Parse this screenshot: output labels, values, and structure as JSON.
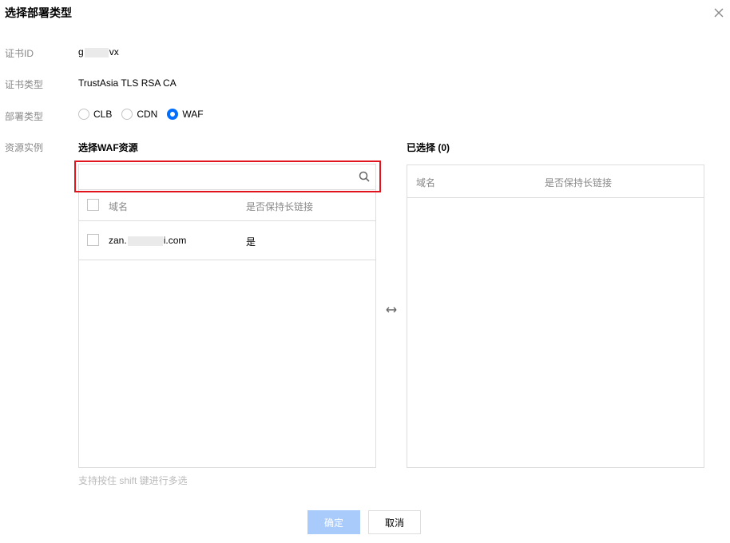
{
  "dialog": {
    "title": "选择部署类型"
  },
  "form": {
    "cert_id_label": "证书ID",
    "cert_id_prefix": "g",
    "cert_id_suffix": "vx",
    "cert_type_label": "证书类型",
    "cert_type_value": "TrustAsia TLS RSA CA",
    "deploy_type_label": "部署类型",
    "deploy_options": [
      {
        "label": "CLB",
        "selected": false
      },
      {
        "label": "CDN",
        "selected": false
      },
      {
        "label": "WAF",
        "selected": true
      }
    ],
    "resource_label": "资源实例"
  },
  "left_panel": {
    "title": "选择WAF资源",
    "search": {
      "value": "",
      "placeholder": ""
    },
    "columns": [
      "域名",
      "是否保持长链接"
    ],
    "rows": [
      {
        "domain_prefix": "zan.",
        "domain_suffix": "i.com",
        "keepalive": "是"
      }
    ],
    "hint": "支持按住 shift 键进行多选"
  },
  "right_panel": {
    "title": "已选择 (0)",
    "columns": [
      "域名",
      "是否保持长链接"
    ]
  },
  "footer": {
    "confirm_label": "确定",
    "cancel_label": "取消"
  },
  "colors": {
    "accent": "#006eff",
    "highlight_box": "#e1141e",
    "confirm_disabled": "#a9cbfb"
  }
}
